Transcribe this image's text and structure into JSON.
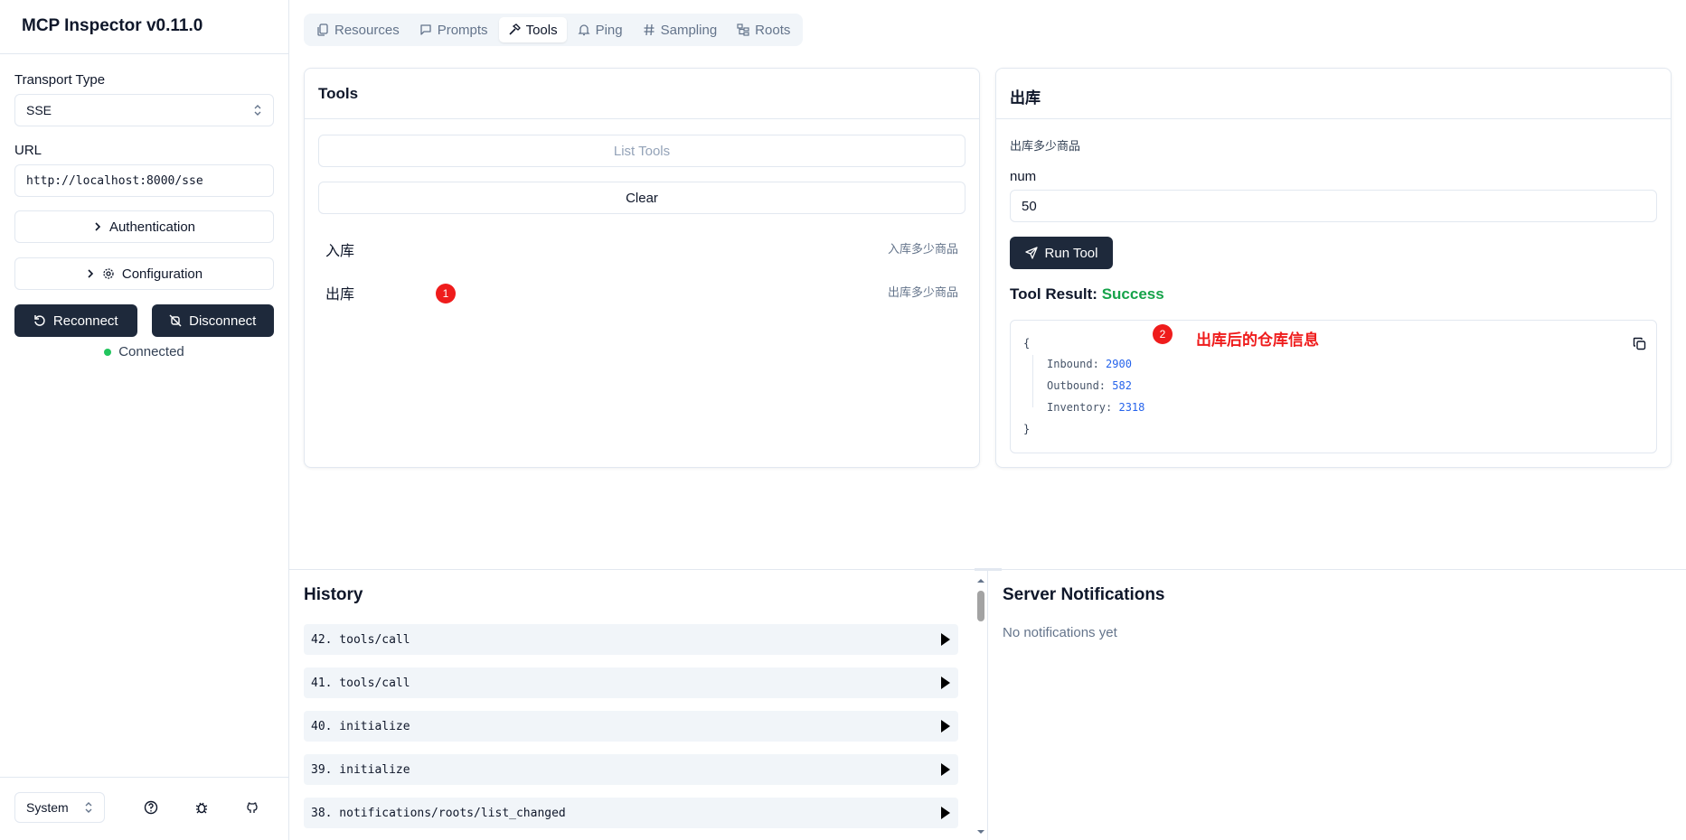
{
  "app": {
    "title": "MCP Inspector v0.11.0"
  },
  "sidebar": {
    "transport_label": "Transport Type",
    "transport_value": "SSE",
    "url_label": "URL",
    "url_value": "http://localhost:8000/sse",
    "auth_label": "Authentication",
    "config_label": "Configuration",
    "reconnect_label": "Reconnect",
    "disconnect_label": "Disconnect",
    "status_text": "Connected",
    "status_color": "#22c55e",
    "theme_value": "System"
  },
  "tabs": [
    {
      "label": "Resources",
      "icon": "files-icon"
    },
    {
      "label": "Prompts",
      "icon": "message-square-icon"
    },
    {
      "label": "Tools",
      "icon": "hammer-icon"
    },
    {
      "label": "Ping",
      "icon": "bell-icon"
    },
    {
      "label": "Sampling",
      "icon": "hash-icon"
    },
    {
      "label": "Roots",
      "icon": "folder-tree-icon"
    }
  ],
  "tools_panel": {
    "title": "Tools",
    "list_button": "List Tools",
    "clear_button": "Clear",
    "items": [
      {
        "name": "入库",
        "description": "入库多少商品"
      },
      {
        "name": "出库",
        "description": "出库多少商品"
      }
    ],
    "marker1": "1"
  },
  "tool_detail": {
    "title": "出库",
    "description": "出库多少商品",
    "param_label": "num",
    "param_value": "50",
    "run_button": "Run Tool",
    "result_label": "Tool Result:",
    "result_status": "Success",
    "result_color": "#16a34a",
    "marker2": "2",
    "annotation": "出库后的仓库信息",
    "json_open": "{",
    "json_close": "}",
    "json_lines": [
      {
        "key": "Inbound:",
        "value": "2900"
      },
      {
        "key": "Outbound:",
        "value": "582"
      },
      {
        "key": "Inventory:",
        "value": "2318"
      }
    ]
  },
  "history": {
    "title": "History",
    "items": [
      "42. tools/call",
      "41. tools/call",
      "40. initialize",
      "39. initialize",
      "38. notifications/roots/list_changed"
    ]
  },
  "notifications": {
    "title": "Server Notifications",
    "empty_text": "No notifications yet"
  }
}
